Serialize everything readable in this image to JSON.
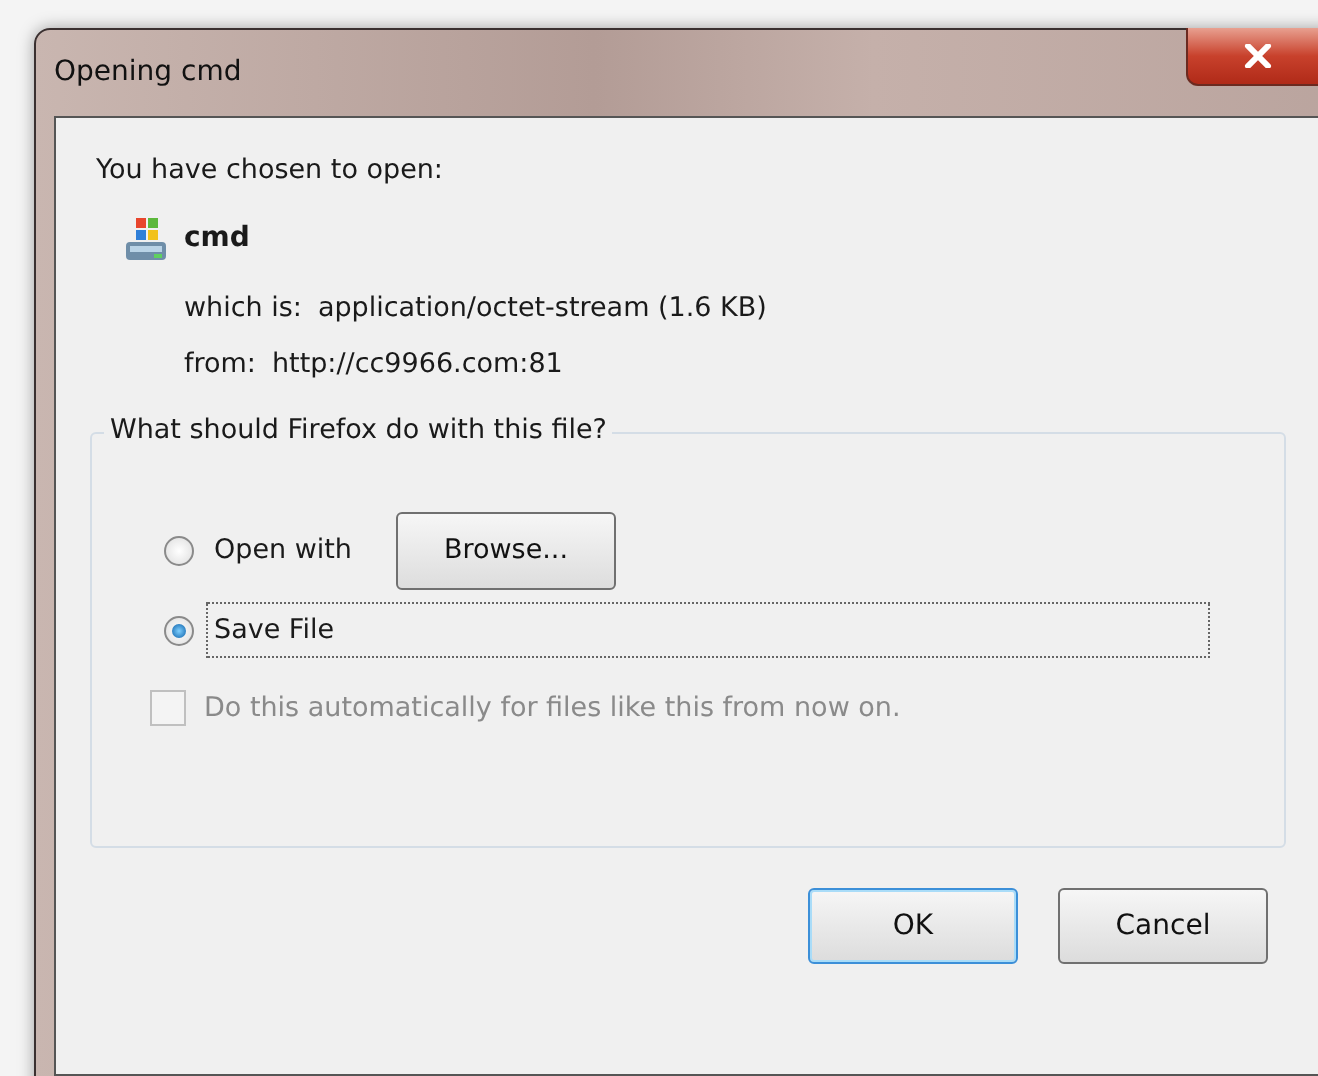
{
  "window": {
    "title": "Opening cmd"
  },
  "intro": "You have chosen to open:",
  "file": {
    "name": "cmd"
  },
  "details": [
    {
      "label": "which is:",
      "value": "application/octet-stream (1.6 KB)"
    },
    {
      "label": "from:",
      "value": "http://cc9966.com:81"
    }
  ],
  "action_group": {
    "legend": "What should Firefox do with this file?",
    "options": [
      {
        "label": "Open with",
        "selected": false,
        "focused": false,
        "button": "Browse..."
      },
      {
        "label": "Save File",
        "selected": true,
        "focused": true
      }
    ],
    "auto_checkbox": {
      "label": "Do this automatically for files like this from now on.",
      "checked": false,
      "disabled": true
    }
  },
  "buttons": [
    {
      "label": "OK",
      "default": true
    },
    {
      "label": "Cancel",
      "default": false
    }
  ]
}
